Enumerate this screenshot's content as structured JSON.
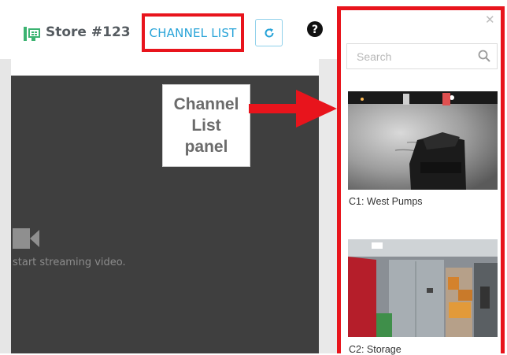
{
  "header": {
    "store_name": "Store #123",
    "channel_list_label": "CHANNEL LIST",
    "icons": {
      "store": "store-icon",
      "refresh": "refresh-icon",
      "help": "help-icon"
    }
  },
  "video": {
    "message": "start streaming video.",
    "icon": "video-camera-icon"
  },
  "annotation": {
    "lines": [
      "Channel",
      "List",
      "panel"
    ]
  },
  "panel": {
    "close_icon": "close-icon",
    "search_placeholder": "Search",
    "channels": [
      {
        "label": "C1: West Pumps"
      },
      {
        "label": "C2: Storage"
      }
    ]
  },
  "colors": {
    "accent_blue": "#27a3d8",
    "highlight_red": "#e8141c",
    "store_green": "#3cb371",
    "video_bg": "#3f3f3f"
  }
}
